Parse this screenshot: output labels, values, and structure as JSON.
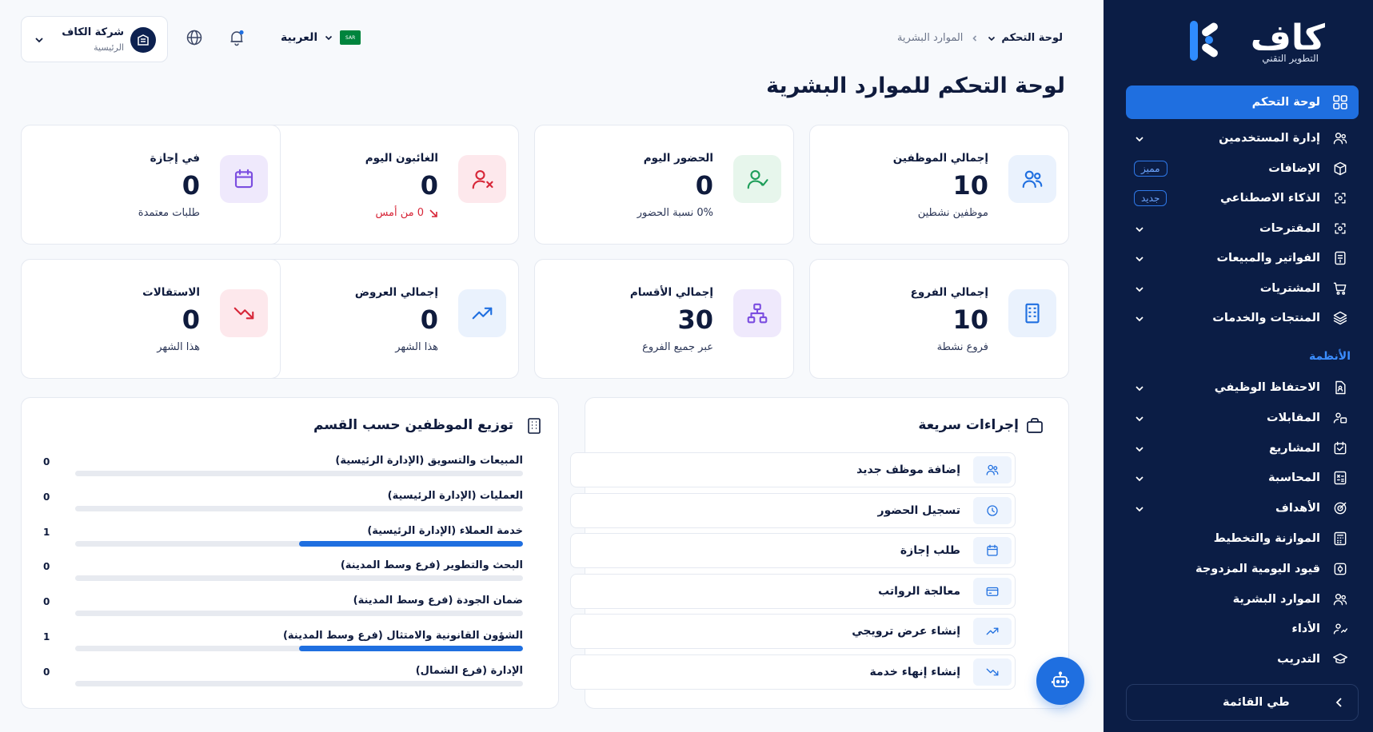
{
  "sidebar": {
    "logo": {
      "word": "كاف",
      "tagline": "التطوير التقني"
    },
    "active": {
      "label": "لوحة التحكم",
      "icon": "grid-icon"
    },
    "items": [
      {
        "label": "إدارة المستخدمين",
        "icon": "users-icon",
        "chevron": true
      },
      {
        "label": "الإضافات",
        "icon": "box-icon",
        "badge": "مميز"
      },
      {
        "label": "الذكاء الاصطناعي",
        "icon": "ai-icon",
        "badge": "جديد"
      },
      {
        "label": "المقترحات",
        "icon": "ai-icon",
        "chevron": true
      },
      {
        "label": "الفواتير والمبيعات",
        "icon": "invoice-icon",
        "chevron": true
      },
      {
        "label": "المشتريات",
        "icon": "cart-icon",
        "chevron": true
      },
      {
        "label": "المنتجات والخدمات",
        "icon": "layers-icon",
        "chevron": true
      }
    ],
    "section_label": "الأنظمة",
    "system_items": [
      {
        "label": "الاحتفاظ الوظيفي",
        "icon": "file-user-icon",
        "chevron": true
      },
      {
        "label": "المقابلات",
        "icon": "interview-icon",
        "chevron": true
      },
      {
        "label": "المشاريع",
        "icon": "project-icon",
        "chevron": true
      },
      {
        "label": "المحاسبة",
        "icon": "calculator-icon",
        "chevron": true
      },
      {
        "label": "الأهداف",
        "icon": "target-icon",
        "chevron": true
      },
      {
        "label": "الموازنة والتخطيط",
        "icon": "budget-icon"
      },
      {
        "label": "قيود اليومية المزدوجة",
        "icon": "journal-icon"
      },
      {
        "label": "الموارد البشرية",
        "icon": "users-icon"
      },
      {
        "label": "الأداء",
        "icon": "performance-icon"
      },
      {
        "label": "التدريب",
        "icon": "graduation-icon"
      }
    ],
    "collapse_label": "طي القائمة"
  },
  "header": {
    "breadcrumb_home": "لوحة التحكم",
    "breadcrumb_current": "الموارد البشرية",
    "page_title": "لوحة التحكم للموارد البشرية",
    "language": "العربية",
    "flag_text": "SAR",
    "company_name": "شركة الكاف",
    "company_branch": "الرئيسية"
  },
  "stats": [
    {
      "title": "إجمالي الموظفين",
      "value": "10",
      "sub": "موظفين نشطين",
      "icon": "users-icon",
      "color": "#1f6fe0",
      "bg": "#eaf2fd"
    },
    {
      "title": "الحضور اليوم",
      "value": "0",
      "sub": "0% نسبة الحضور",
      "icon": "user-check-icon",
      "color": "#1e9e5a",
      "bg": "#e7f6ec"
    },
    {
      "title": "الغائبون اليوم",
      "value": "0",
      "sub": "0 من أمس",
      "icon": "user-x-icon",
      "color": "#d72638",
      "bg": "#fde8ec",
      "red": true
    },
    {
      "title": "في إجازة",
      "value": "0",
      "sub": "طلبات معتمدة",
      "icon": "calendar-icon",
      "color": "#7b4de0",
      "bg": "#efe9fc"
    },
    {
      "title": "إجمالي الفروع",
      "value": "10",
      "sub": "فروع نشطة",
      "icon": "building-icon",
      "color": "#1f6fe0",
      "bg": "#eaf2fd"
    },
    {
      "title": "إجمالي الأقسام",
      "value": "30",
      "sub": "عبر جميع الفروع",
      "icon": "org-icon",
      "color": "#7b4de0",
      "bg": "#efe9fc"
    },
    {
      "title": "إجمالي العروض",
      "value": "0",
      "sub": "هذا الشهر",
      "icon": "trend-up-icon",
      "color": "#1f6fe0",
      "bg": "#eaf2fd"
    },
    {
      "title": "الاستقالات",
      "value": "0",
      "sub": "هذا الشهر",
      "icon": "trend-down-icon",
      "color": "#d72638",
      "bg": "#fde8ec"
    }
  ],
  "quick_actions": {
    "title": "إجراءات سريعة",
    "items": [
      {
        "label": "إضافة موظف جديد",
        "icon": "users-icon"
      },
      {
        "label": "تسجيل الحضور",
        "icon": "clock-icon"
      },
      {
        "label": "طلب إجازة",
        "icon": "calendar-icon"
      },
      {
        "label": "معالجة الرواتب",
        "icon": "card-icon"
      },
      {
        "label": "إنشاء عرض ترويجي",
        "icon": "trend-up-icon"
      },
      {
        "label": "إنشاء إنهاء خدمة",
        "icon": "trend-down-icon"
      }
    ]
  },
  "departments": {
    "title": "توزيع الموظفين حسب القسم",
    "max": 2,
    "rows": [
      {
        "name": "المبيعات والتسويق (الإدارة الرئيسية)",
        "count": 0
      },
      {
        "name": "العمليات (الإدارة الرئيسية)",
        "count": 0
      },
      {
        "name": "خدمة العملاء (الإدارة الرئيسية)",
        "count": 1
      },
      {
        "name": "البحث والتطوير (فرع وسط المدينة)",
        "count": 0
      },
      {
        "name": "ضمان الجودة (فرع وسط المدينة)",
        "count": 0
      },
      {
        "name": "الشؤون القانونية والامتثال (فرع وسط المدينة)",
        "count": 1
      },
      {
        "name": "الإدارة (فرع الشمال)",
        "count": 0
      }
    ]
  }
}
